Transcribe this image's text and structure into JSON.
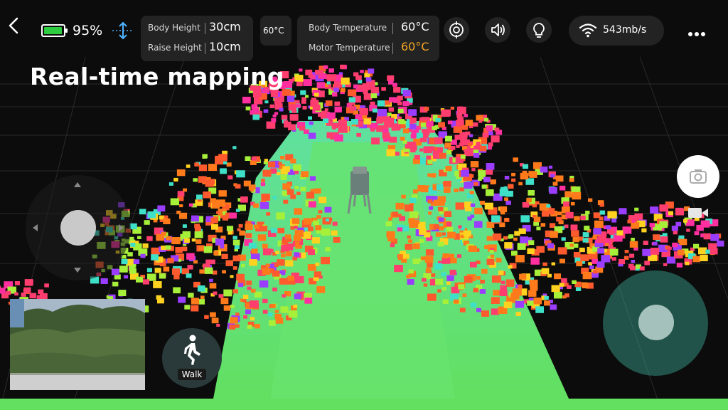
{
  "status": {
    "battery_percent": 95,
    "battery_text": "95%"
  },
  "body_height": {
    "label": "Body Height",
    "value": "30cm"
  },
  "raise_height": {
    "label": "Raise Height",
    "value": "10cm"
  },
  "ambient_temp": "60°C",
  "body_temperature": {
    "label": "Body Temperature",
    "value": "60°C"
  },
  "motor_temperature": {
    "label": "Motor Temperature",
    "value": "60°C"
  },
  "network": {
    "speed": "543mb/s"
  },
  "page_title": "Real-time mapping",
  "mode_button": {
    "label": "Walk"
  },
  "colors": {
    "battery": "#2ecc40",
    "motor_temp_warning": "#f5a623",
    "ground": "#5de06a"
  },
  "icons": {
    "back": "chevron-left-icon",
    "height": "height-adjust-icon",
    "target": "target-icon",
    "volume": "volume-icon",
    "light": "lightbulb-icon",
    "wifi": "wifi-icon",
    "more": "more-dots-icon",
    "camera": "camera-icon",
    "video": "video-icon",
    "walk": "walking-person-icon"
  }
}
